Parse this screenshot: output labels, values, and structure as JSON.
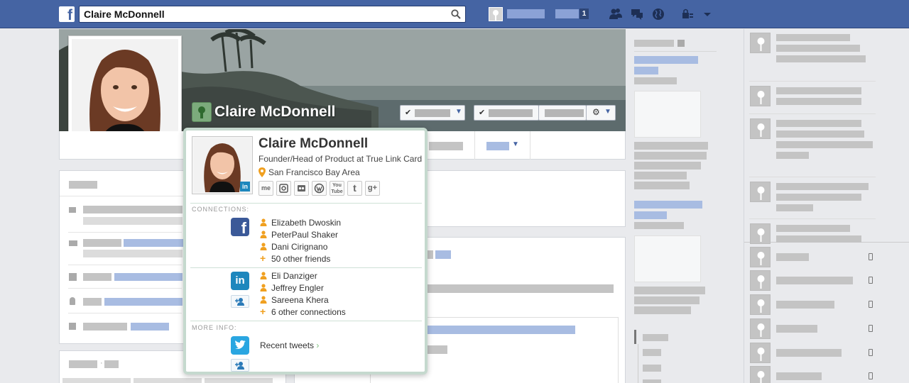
{
  "search": {
    "value": "Claire McDonnell",
    "placeholder": ""
  },
  "topbar": {
    "notification_count": "1"
  },
  "profile": {
    "cover_name": "Claire McDonnell"
  },
  "hovercard": {
    "name": "Claire McDonnell",
    "title": "Founder/Head of Product at True Link Card",
    "location": "San Francisco Bay Area",
    "social_links": [
      "me",
      "instagram",
      "flickr",
      "wordpress",
      "youtube",
      "tumblr",
      "google-plus"
    ],
    "sections": {
      "connections": "CONNECTIONS:",
      "more_info": "MORE INFO:"
    },
    "facebook": {
      "items": [
        "Elizabeth Dwoskin",
        "PeterPaul Shaker",
        "Dani Cirignano"
      ],
      "more": "50 other friends"
    },
    "linkedin": {
      "items": [
        "Eli Danziger",
        "Jeffrey Engler",
        "Sareena Khera"
      ],
      "more": "6 other connections"
    },
    "twitter": {
      "link": "Recent tweets"
    }
  },
  "colors": {
    "facebook_blue": "#3b5998",
    "linkedin_blue": "#1d87bd",
    "twitter_blue": "#2aa6e1",
    "accent_orange": "#f0a020",
    "placeholder_gray": "#c4c4c4",
    "placeholder_blue": "#a8bce2"
  },
  "icons": [
    "facebook-logo-icon",
    "search-icon",
    "friend-requests-icon",
    "messages-icon",
    "globe-icon",
    "privacy-lock-icon",
    "chevron-down-icon",
    "location-pin-icon",
    "person-icon",
    "plus-icon",
    "add-contact-icon",
    "twitter-icon",
    "phone-icon",
    "settings-gear-icon"
  ]
}
